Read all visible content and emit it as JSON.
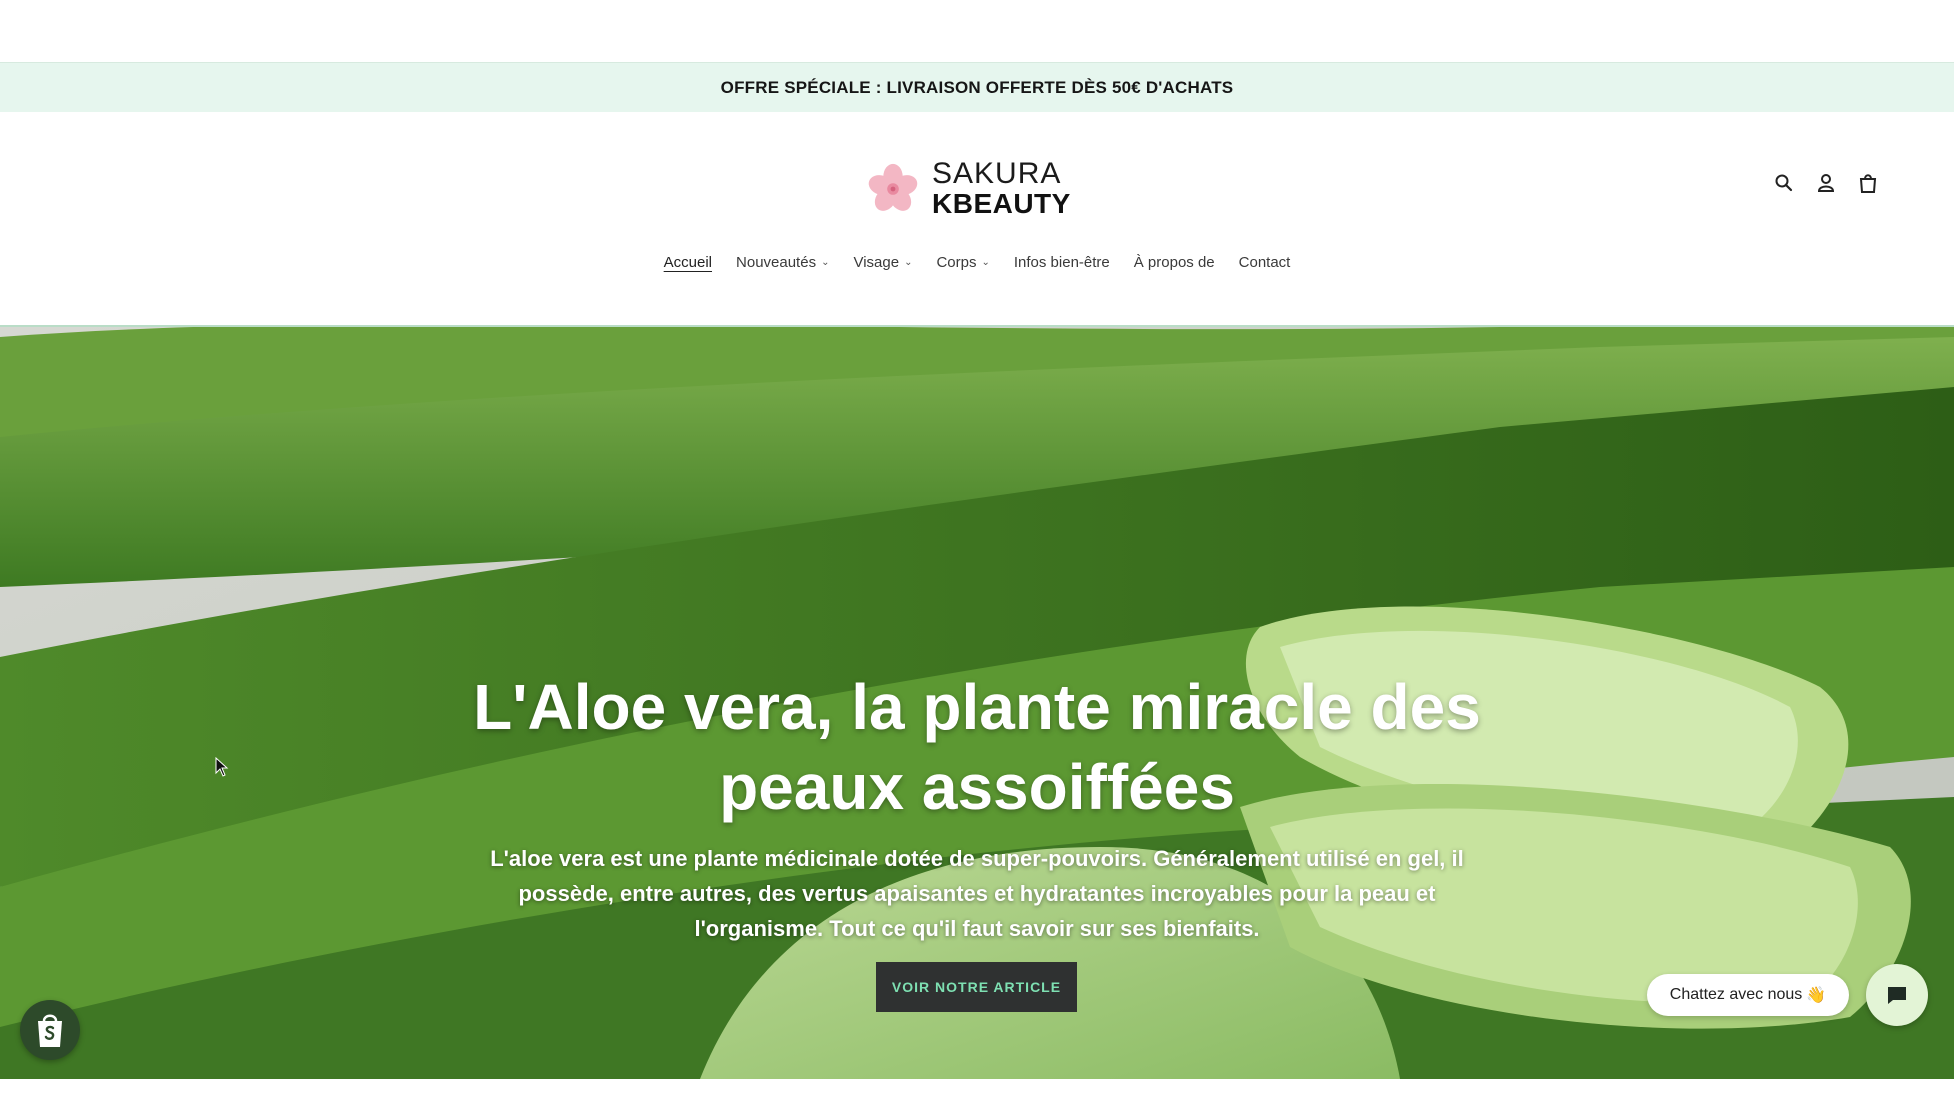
{
  "announcement": {
    "text": "OFFRE SPÉCIALE : LIVRAISON OFFERTE DÈS 50€ D'ACHATS"
  },
  "logo": {
    "line1": "SAKURA",
    "line2": "KBEAUTY"
  },
  "nav": [
    {
      "label": "Accueil",
      "active": true,
      "dropdown": false
    },
    {
      "label": "Nouveautés",
      "active": false,
      "dropdown": true
    },
    {
      "label": "Visage",
      "active": false,
      "dropdown": true
    },
    {
      "label": "Corps",
      "active": false,
      "dropdown": true
    },
    {
      "label": "Infos bien-être",
      "active": false,
      "dropdown": false
    },
    {
      "label": "À propos de",
      "active": false,
      "dropdown": false
    },
    {
      "label": "Contact",
      "active": false,
      "dropdown": false
    }
  ],
  "header_icons": [
    "search-icon",
    "account-icon",
    "cart-icon"
  ],
  "hero": {
    "title": "L'Aloe vera, la plante miracle des peaux assoiffées",
    "description": "L'aloe vera est une plante médicinale dotée de super-pouvoirs. Généralement utilisé en gel, il possède, entre autres, des vertus apaisantes et hydratantes incroyables pour la peau et l'organisme. Tout ce qu'il faut savoir sur ses bienfaits.",
    "cta_label": "VOIR NOTRE ARTICLE"
  },
  "chat": {
    "label": "Chattez avec nous",
    "emoji": "👋"
  },
  "colors": {
    "announcement_bg": "#e6f6ee",
    "cta_bg": "#2f3131",
    "cta_text": "#7ee0b2",
    "chat_bubble": "#e3f4d6"
  }
}
